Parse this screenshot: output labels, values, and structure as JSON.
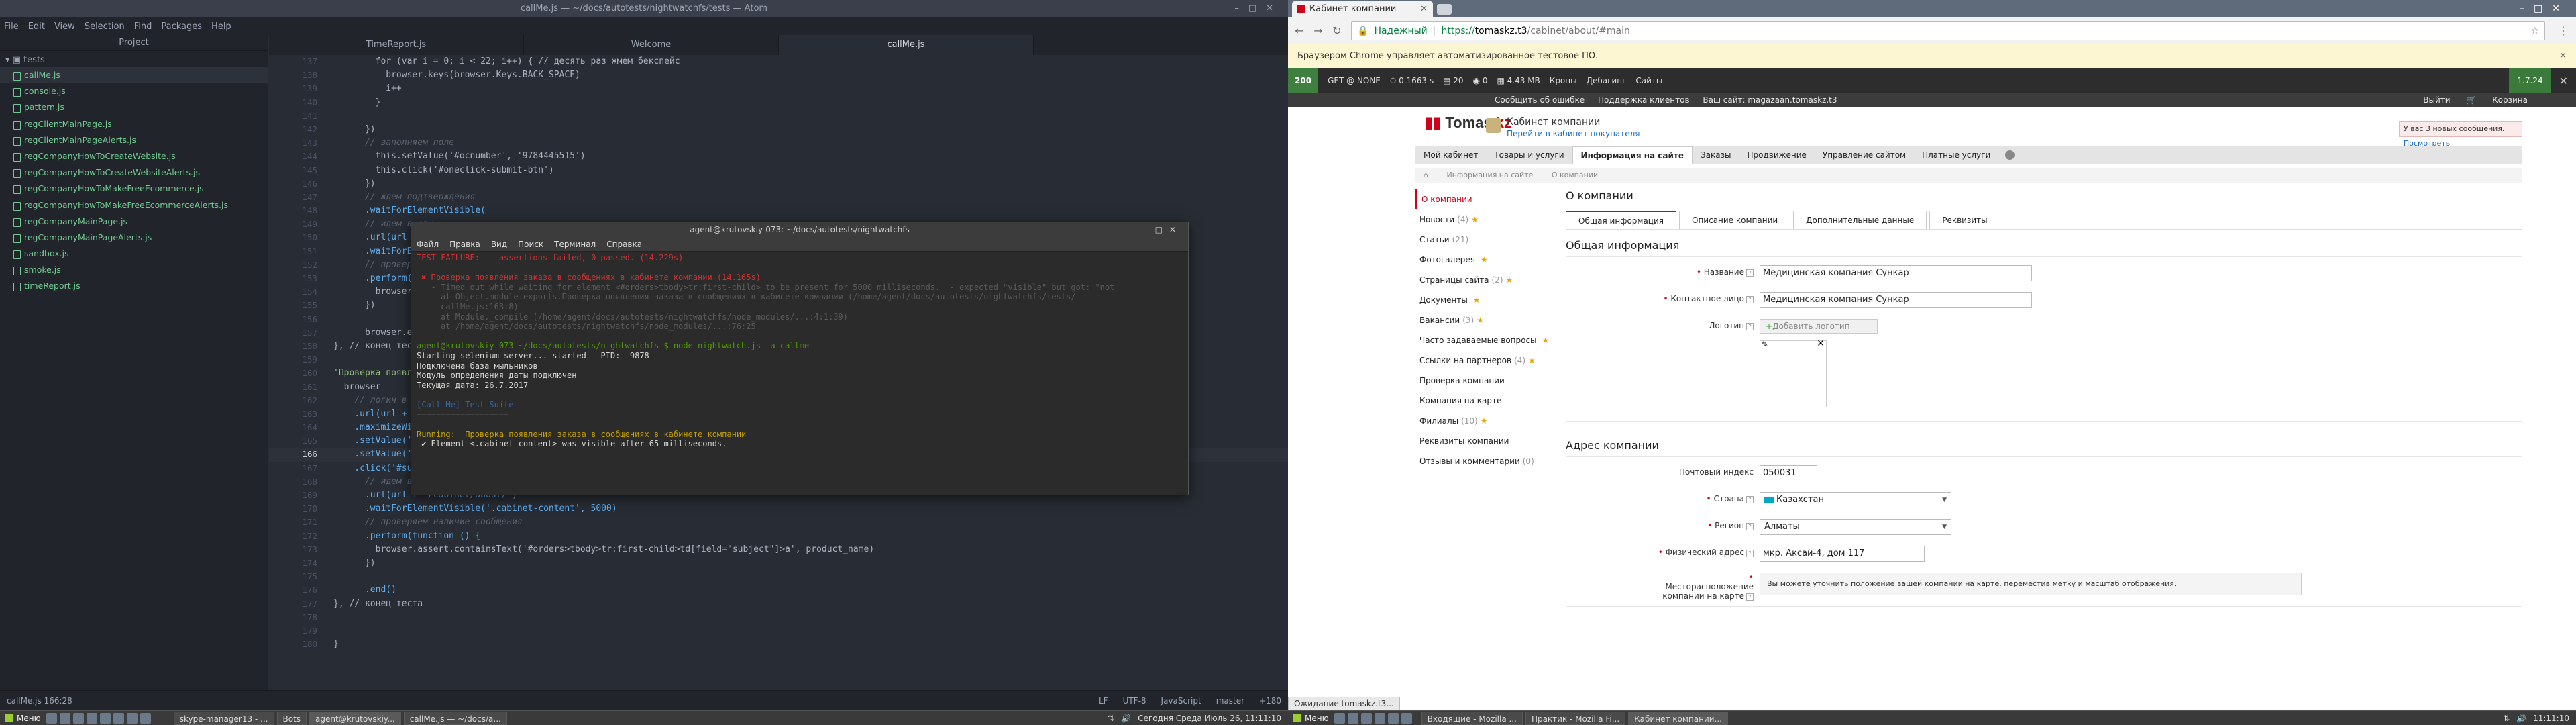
{
  "atom": {
    "title": "callMe.js — ~/docs/autotests/nightwatchfs/tests — Atom",
    "menu": [
      "File",
      "Edit",
      "View",
      "Selection",
      "Find",
      "Packages",
      "Help"
    ],
    "tree_header": "Project",
    "tree_root": "tests",
    "files": [
      "callMe.js",
      "console.js",
      "pattern.js",
      "regClientMainPage.js",
      "regClientMainPageAlerts.js",
      "regCompanyHowToCreateWebsite.js",
      "regCompanyHowToCreateWebsiteAlerts.js",
      "regCompanyHowToMakeFreeEcommerce.js",
      "regCompanyHowToMakeFreeEcommerceAlerts.js",
      "regCompanyMainPage.js",
      "regCompanyMainPageAlerts.js",
      "sandbox.js",
      "smoke.js",
      "timeReport.js"
    ],
    "tabs": [
      "TimeReport.js",
      "Welcome",
      "callMe.js"
    ],
    "line_numbers": [
      "137",
      "138",
      "139",
      "140",
      "141",
      "142",
      "143",
      "144",
      "145",
      "146",
      "147",
      "148",
      "149",
      "150",
      "151",
      "152",
      "153",
      "154",
      "155",
      "156",
      "157",
      "158",
      "159",
      "160",
      "161",
      "162",
      "163",
      "164",
      "165",
      "166",
      "167",
      "168",
      "169",
      "170",
      "171",
      "172",
      "173",
      "174",
      "175",
      "176",
      "177",
      "178",
      "179",
      "180"
    ],
    "code": [
      "        for (var i = 0; i < 22; i++) { // десять раз жмем бекспейс",
      "          browser.keys(browser.Keys.BACK_SPACE)",
      "          i++",
      "        }",
      "",
      "      })",
      "      // заполняем поле",
      "        this.setValue('#ocnumber', '9784445515')",
      "        this.click('#oneclick-submit-btn')",
      "      })",
      "      // ждем подтверждения",
      "      .waitForElementVisible(",
      "      // идем в сту",
      "      .url(url + '",
      "      .waitForElem",
      "      // проверяем",
      "      .perform(fun",
      "        browser.ass",
      "      })",
      "",
      "      browser.end()",
      "}, // конец теста",
      "",
      "'Проверка появлени",
      "  browser",
      "    // логин в кабин",
      "    .url(url + '/reg",
      "    .maximizeWindow(",
      "    .setValue('#logi",
      "    .setValue('#pass",
      "    .click('#submit",
      "      // идем в стр",
      "      .url(url + '/cabinet/about/')",
      "      .waitForElementVisible('.cabinet-content', 5000)",
      "      // проверяем наличие сообщения",
      "      .perform(function () {",
      "        browser.assert.containsText('#orders>tbody>tr:first-child>td[field=\"subject\"]>a', product_name)",
      "      })",
      "",
      "      .end()",
      "}, // конец теста",
      "",
      "",
      "}"
    ],
    "status_left": "callMe.js   166:28",
    "status_right": [
      "LF",
      "UTF-8",
      "JavaScript",
      "master",
      "+180"
    ]
  },
  "terminal": {
    "title": "agent@krutovskiy-073: ~/docs/autotests/nightwatchfs",
    "menu": [
      "Файл",
      "Правка",
      "Вид",
      "Поиск",
      "Терминал",
      "Справка"
    ],
    "lines": [
      {
        "t": "TEST FAILURE:    assertions failed, 0 passed. (14.229s)",
        "c": "red"
      },
      {
        "t": "",
        "c": ""
      },
      {
        "t": " ✖ Проверка появления заказа в сообщениях в кабинете компании (14.165s)",
        "c": "red"
      },
      {
        "t": "   - Timed out while waiting for element <#orders>tbody>tr:first-child> to be present for 5000 milliseconds.  - expected \"visible\" but got: \"not",
        "c": "dim"
      },
      {
        "t": "     at Object.module.exports.Проверка появления заказа в сообщениях в кабинете компании (/home/agent/docs/autotests/nightwatchfs/tests/",
        "c": "dim"
      },
      {
        "t": "     callMe.js:163:8)",
        "c": "dim"
      },
      {
        "t": "     at Module._compile (/home/agent/docs/autotests/nightwatchfs/node_modules/...:4:1:39)",
        "c": "dim"
      },
      {
        "t": "     at /home/agent/docs/autotests/nightwatchfs/node_modules/...:76:25",
        "c": "dim"
      },
      {
        "t": "",
        "c": ""
      },
      {
        "t": "agent@krutovskiy-073 ~/docs/autotests/nightwatchfs $ node nightwatch.js -a callme",
        "c": "green"
      },
      {
        "t": "Starting selenium server... started - PID:  9878",
        "c": ""
      },
      {
        "t": "Подключена база мыльников",
        "c": ""
      },
      {
        "t": "Модуль определения даты подключен",
        "c": ""
      },
      {
        "t": "Текущая дата: 26.7.2017",
        "c": ""
      },
      {
        "t": "",
        "c": ""
      },
      {
        "t": "[Call Me] Test Suite",
        "c": "blue"
      },
      {
        "t": "===================",
        "c": "dim"
      },
      {
        "t": "",
        "c": ""
      },
      {
        "t": "Running:  Проверка появления заказа в сообщениях в кабинете компании",
        "c": "yel"
      },
      {
        "t": " ✔ Element <.cabinet-content> was visible after 65 milliseconds.",
        "c": ""
      },
      {
        "t": "",
        "c": ""
      }
    ]
  },
  "chrome": {
    "tab_title": "Кабинет компании",
    "url_secure": "Надежный",
    "url_scheme": "https://",
    "url_host": "tomaskz.t3",
    "url_path": "/cabinet/about/#main",
    "infobar": "Браузером Chrome управляет автоматизированное тестовое ПО.",
    "status": "Ожидание tomaskz.t3..."
  },
  "debugbar": {
    "code": "200",
    "items": [
      "GET @ NONE",
      "0.1663 s",
      "20",
      "0",
      "4.43 MB",
      "Кроны",
      "Дебагинг",
      "Сайты"
    ],
    "version": "1.7.24"
  },
  "adminbar": {
    "left": [
      "Сообщить об ошибке",
      "Поддержка клиентов",
      "Ваш сайт: magazaan.tomaskz.t3"
    ],
    "right": [
      "Выйти",
      "Корзина"
    ]
  },
  "site": {
    "logo": "Tomas",
    "logo_suffix": ".kz",
    "cabinet_title": "Кабинет компании",
    "cabinet_link": "Перейти в кабинет покупателя",
    "notice_text": "У вас 3 новых сообщения.",
    "notice_link": "Посмотреть",
    "nav": [
      "Мой кабинет",
      "Товары и услуги",
      "Информация на сайте",
      "Заказы",
      "Продвижение",
      "Управление сайтом",
      "Платные услуги"
    ],
    "breadcrumb": [
      "Информация на сайте",
      "О компании"
    ],
    "side_menu": [
      {
        "label": "О компании",
        "count": "",
        "star": false
      },
      {
        "label": "Новости",
        "count": "(4)",
        "star": true
      },
      {
        "label": "Статьи",
        "count": "(21)",
        "star": false
      },
      {
        "label": "Фотогалерея",
        "count": "",
        "star": true
      },
      {
        "label": "Страницы сайта",
        "count": "(2)",
        "star": true
      },
      {
        "label": "Документы",
        "count": "",
        "star": true
      },
      {
        "label": "Вакансии",
        "count": "(3)",
        "star": true
      },
      {
        "label": "Часто задаваемые вопросы",
        "count": "",
        "star": true
      },
      {
        "label": "Ссылки на партнеров",
        "count": "(4)",
        "star": true
      },
      {
        "label": "Проверка компании",
        "count": "",
        "star": false
      },
      {
        "label": "Компания на карте",
        "count": "",
        "star": false
      },
      {
        "label": "Филиалы",
        "count": "(10)",
        "star": true
      },
      {
        "label": "Реквизиты компании",
        "count": "",
        "star": false
      },
      {
        "label": "Отзывы и комментарии",
        "count": "(0)",
        "star": false
      }
    ],
    "page_title": "О компании",
    "sub_tabs": [
      "Общая информация",
      "Описание компании",
      "Дополнительные данные",
      "Реквизиты"
    ],
    "sec_general": "Общая информация",
    "f_name_label": "Название",
    "f_name_value": "Медицинская компания Сункар",
    "f_contact_label": "Контактное лицо",
    "f_contact_value": "Медицинская компания Сункар",
    "f_logo_label": "Логотип",
    "f_logo_btn": "Добавить логотип",
    "sec_address": "Адрес компании",
    "f_zip_label": "Почтовый индекс",
    "f_zip_value": "050031",
    "f_country_label": "Страна",
    "f_country_value": "Казахстан",
    "f_region_label": "Регион",
    "f_region_value": "Алматы",
    "f_addr_label": "Физический адрес",
    "f_addr_value": "мкр. Аксай-4, дом 117",
    "f_map_label": "Месторасположение компании на карте",
    "f_map_value": "Вы можете уточнить положение вашей компании на карте, переместив метку и масштаб отображения."
  },
  "taskbar_left": {
    "start": "Меню",
    "tasks": [
      "skype-manager13 - ...",
      "Bots",
      "agent@krutovskiy...",
      "callMe.js — ~/docs/a..."
    ],
    "tray": "Сегодня Среда Июль 26, 11:11:10"
  },
  "taskbar_right": {
    "start": "Меню",
    "tasks": [
      "Входящие - Mozilla ...",
      "Практик - Mozilla Fi...",
      "Кабинет компании..."
    ],
    "tray": "11:11:10"
  }
}
